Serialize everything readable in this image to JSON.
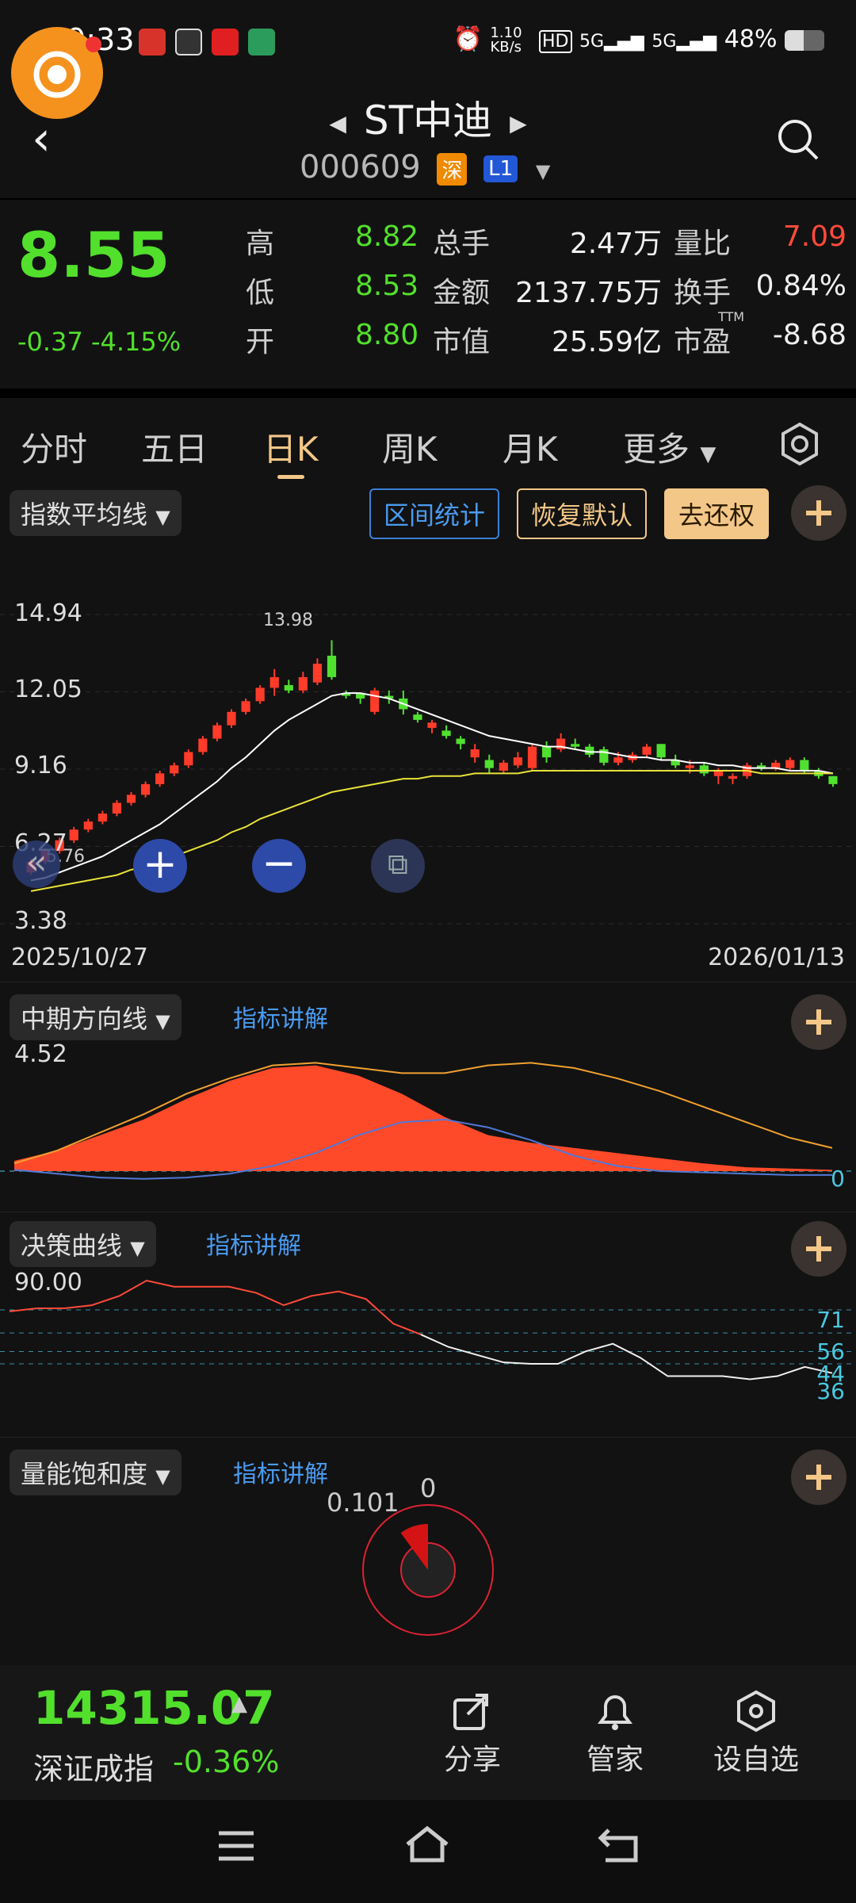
{
  "status_bar": {
    "time": "09:33",
    "net_speed": "1.10 KB/s",
    "signal1": "5G",
    "signal2": "5G",
    "battery": "48%"
  },
  "header": {
    "name": "ST中迪",
    "code": "000609",
    "tag_market": "深",
    "tag_level": "L1"
  },
  "quote": {
    "price": "8.55",
    "change": "-0.37",
    "change_pct": "-4.15%",
    "high_label": "高",
    "high": "8.82",
    "low_label": "低",
    "low": "8.53",
    "open_label": "开",
    "open": "8.80",
    "vol_label": "总手",
    "vol": "2.47万",
    "amt_label": "金额",
    "amt": "2137.75万",
    "mcap_label": "市值",
    "mcap": "25.59亿",
    "ratio_label": "量比",
    "ratio": "7.09",
    "turnover_label": "换手",
    "turnover": "0.84%",
    "pe_label": "市盈",
    "pe_sup": "TTM",
    "pe": "-8.68"
  },
  "tabs": [
    "分时",
    "五日",
    "日K",
    "周K",
    "月K",
    "更多"
  ],
  "active_tab": "日K",
  "toolbar": {
    "indicator": "指数平均线",
    "range_stats": "区间统计",
    "restore_default": "恢复默认",
    "adjust": "去还权"
  },
  "main_chart": {
    "y_ticks": [
      "14.94",
      "12.05",
      "9.16",
      "6.27",
      "3.38"
    ],
    "peak_label": "13.98",
    "low_label": "5.76",
    "date_start": "2025/10/27",
    "date_end": "2026/01/13"
  },
  "panel2": {
    "name": "中期方向线",
    "explain": "指标讲解",
    "top": "4.52",
    "zero": "0"
  },
  "panel3": {
    "name": "决策曲线",
    "explain": "指标讲解",
    "top": "90.00",
    "levels": [
      "71",
      "56",
      "44",
      "36"
    ]
  },
  "panel4": {
    "name": "量能饱和度",
    "explain": "指标讲解",
    "v1": "0.101",
    "v2": "0"
  },
  "bottom": {
    "index_value": "14315.07",
    "index_name": "深证成指",
    "index_change": "-0.36%",
    "share": "分享",
    "manager": "管家",
    "add_watch": "设自选"
  },
  "chart_data": [
    {
      "type": "candlestick",
      "title": "",
      "x_range": [
        "2025/10/27",
        "2026/01/13"
      ],
      "ylim": [
        3.38,
        14.94
      ],
      "y_ticks": [
        14.94,
        12.05,
        9.16,
        6.27,
        3.38
      ],
      "series": [
        {
          "name": "",
          "candles": [
            [
              5.3,
              5.7,
              5.8,
              5.2
            ],
            [
              5.7,
              6.1,
              6.2,
              5.6
            ],
            [
              6.1,
              6.5,
              6.6,
              6.0
            ],
            [
              6.5,
              6.9,
              7.0,
              6.4
            ],
            [
              6.9,
              7.2,
              7.3,
              6.8
            ],
            [
              7.2,
              7.5,
              7.6,
              7.1
            ],
            [
              7.5,
              7.9,
              8.0,
              7.4
            ],
            [
              7.9,
              8.2,
              8.3,
              7.8
            ],
            [
              8.2,
              8.6,
              8.7,
              8.1
            ],
            [
              8.6,
              9.0,
              9.1,
              8.5
            ],
            [
              9.0,
              9.3,
              9.4,
              8.9
            ],
            [
              9.3,
              9.8,
              9.9,
              9.2
            ],
            [
              9.8,
              10.3,
              10.4,
              9.7
            ],
            [
              10.3,
              10.8,
              10.9,
              10.2
            ],
            [
              10.8,
              11.3,
              11.4,
              10.7
            ],
            [
              11.3,
              11.7,
              11.8,
              11.2
            ],
            [
              11.7,
              12.2,
              12.3,
              11.6
            ],
            [
              12.2,
              12.6,
              12.9,
              11.9
            ],
            [
              12.3,
              12.1,
              12.5,
              12.0
            ],
            [
              12.1,
              12.6,
              12.8,
              12.0
            ],
            [
              12.4,
              13.1,
              13.3,
              12.3
            ],
            [
              13.4,
              12.6,
              13.98,
              12.5
            ],
            [
              12.0,
              11.9,
              12.1,
              11.8
            ],
            [
              12.0,
              11.8,
              12.0,
              11.6
            ],
            [
              11.3,
              12.1,
              12.2,
              11.2
            ],
            [
              11.9,
              11.8,
              12.1,
              11.6
            ],
            [
              11.8,
              11.4,
              12.1,
              11.2
            ],
            [
              11.2,
              11.0,
              11.3,
              10.9
            ],
            [
              10.7,
              10.9,
              11.0,
              10.5
            ],
            [
              10.6,
              10.4,
              10.8,
              10.3
            ],
            [
              10.3,
              10.1,
              10.4,
              9.9
            ],
            [
              9.6,
              9.9,
              10.1,
              9.4
            ],
            [
              9.5,
              9.2,
              9.7,
              9.0
            ],
            [
              9.1,
              9.4,
              9.5,
              9.0
            ],
            [
              9.3,
              9.6,
              9.8,
              9.2
            ],
            [
              9.2,
              10.0,
              10.1,
              9.1
            ],
            [
              10.0,
              9.6,
              10.2,
              9.4
            ],
            [
              9.9,
              10.3,
              10.5,
              9.8
            ],
            [
              10.1,
              10.0,
              10.3,
              9.9
            ],
            [
              10.0,
              9.7,
              10.1,
              9.6
            ],
            [
              9.9,
              9.4,
              10.0,
              9.3
            ],
            [
              9.4,
              9.6,
              9.8,
              9.3
            ],
            [
              9.5,
              9.7,
              9.8,
              9.4
            ],
            [
              9.7,
              10.0,
              10.1,
              9.6
            ],
            [
              10.1,
              9.6,
              10.1,
              9.5
            ],
            [
              9.5,
              9.3,
              9.7,
              9.2
            ],
            [
              9.2,
              9.3,
              9.5,
              9.0
            ],
            [
              9.3,
              9.0,
              9.4,
              8.9
            ],
            [
              8.9,
              9.1,
              9.2,
              8.6
            ],
            [
              8.8,
              8.9,
              9.0,
              8.6
            ],
            [
              8.9,
              9.3,
              9.4,
              8.8
            ],
            [
              9.3,
              9.2,
              9.4,
              9.1
            ],
            [
              9.2,
              9.4,
              9.5,
              9.1
            ],
            [
              9.2,
              9.5,
              9.6,
              9.1
            ],
            [
              9.5,
              9.1,
              9.6,
              9.0
            ],
            [
              9.1,
              8.9,
              9.2,
              8.8
            ],
            [
              8.9,
              8.6,
              8.9,
              8.5
            ]
          ]
        },
        {
          "name": "",
          "kind": "ma",
          "color": "#ffffff",
          "values": [
            5.0,
            5.1,
            5.3,
            5.5,
            5.7,
            5.9,
            6.2,
            6.5,
            6.8,
            7.1,
            7.5,
            7.9,
            8.3,
            8.7,
            9.2,
            9.6,
            10.1,
            10.6,
            11.0,
            11.3,
            11.6,
            11.9,
            12.0,
            12.0,
            11.9,
            11.8,
            11.6,
            11.4,
            11.2,
            11.0,
            10.8,
            10.6,
            10.4,
            10.3,
            10.2,
            10.1,
            10.0,
            10.0,
            9.9,
            9.8,
            9.8,
            9.7,
            9.6,
            9.6,
            9.5,
            9.5,
            9.4,
            9.4,
            9.3,
            9.3,
            9.2,
            9.2,
            9.2,
            9.1,
            9.1,
            9.1,
            9.0
          ]
        },
        {
          "name": "",
          "kind": "ma",
          "color": "#e8e23a",
          "values": [
            4.6,
            4.7,
            4.8,
            4.9,
            5.0,
            5.1,
            5.2,
            5.4,
            5.5,
            5.7,
            5.9,
            6.1,
            6.3,
            6.5,
            6.8,
            7.0,
            7.3,
            7.5,
            7.7,
            7.9,
            8.1,
            8.3,
            8.4,
            8.5,
            8.6,
            8.7,
            8.8,
            8.8,
            8.9,
            8.9,
            8.9,
            9.0,
            9.0,
            9.0,
            9.0,
            9.1,
            9.1,
            9.1,
            9.1,
            9.1,
            9.1,
            9.1,
            9.1,
            9.1,
            9.1,
            9.1,
            9.1,
            9.1,
            9.1,
            9.1,
            9.1,
            9.0,
            9.0,
            9.0,
            9.0,
            9.0,
            9.0
          ]
        }
      ]
    },
    {
      "type": "area",
      "title": "中期方向线",
      "ylim": [
        -0.4,
        4.52
      ],
      "series": [
        {
          "name": "",
          "color": "#ff4a2a",
          "values": [
            0.4,
            0.8,
            1.4,
            2.0,
            2.8,
            3.5,
            4.0,
            4.1,
            3.7,
            3.0,
            2.1,
            1.4,
            1.1,
            0.9,
            0.7,
            0.5,
            0.3,
            0.15,
            0.1,
            0.05
          ]
        },
        {
          "name": "",
          "color": "#f0a030",
          "values": [
            0.3,
            0.8,
            1.5,
            2.2,
            3.0,
            3.6,
            4.1,
            4.2,
            4.0,
            3.8,
            3.8,
            4.1,
            4.2,
            4.0,
            3.6,
            3.1,
            2.5,
            1.9,
            1.3,
            0.9
          ]
        },
        {
          "name": "",
          "color": "#5078d8",
          "values": [
            0.05,
            -0.1,
            -0.25,
            -0.3,
            -0.25,
            -0.1,
            0.2,
            0.7,
            1.4,
            1.9,
            2.0,
            1.7,
            1.2,
            0.6,
            0.2,
            0.0,
            -0.05,
            -0.1,
            -0.15,
            -0.15
          ]
        }
      ]
    },
    {
      "type": "line",
      "title": "决策曲线",
      "ylim": [
        0,
        90
      ],
      "levels": [
        71,
        56,
        44,
        36
      ],
      "series": [
        {
          "name": "",
          "values": [
            70,
            72,
            72,
            74,
            80,
            90,
            86,
            86,
            86,
            82,
            74,
            80,
            83,
            78,
            62,
            55,
            47,
            42,
            37,
            36,
            36,
            44,
            49,
            40,
            28,
            28,
            28,
            26,
            28,
            34,
            30
          ]
        }
      ]
    },
    {
      "type": "pie",
      "title": "量能饱和度",
      "values": [
        0.101
      ]
    }
  ]
}
